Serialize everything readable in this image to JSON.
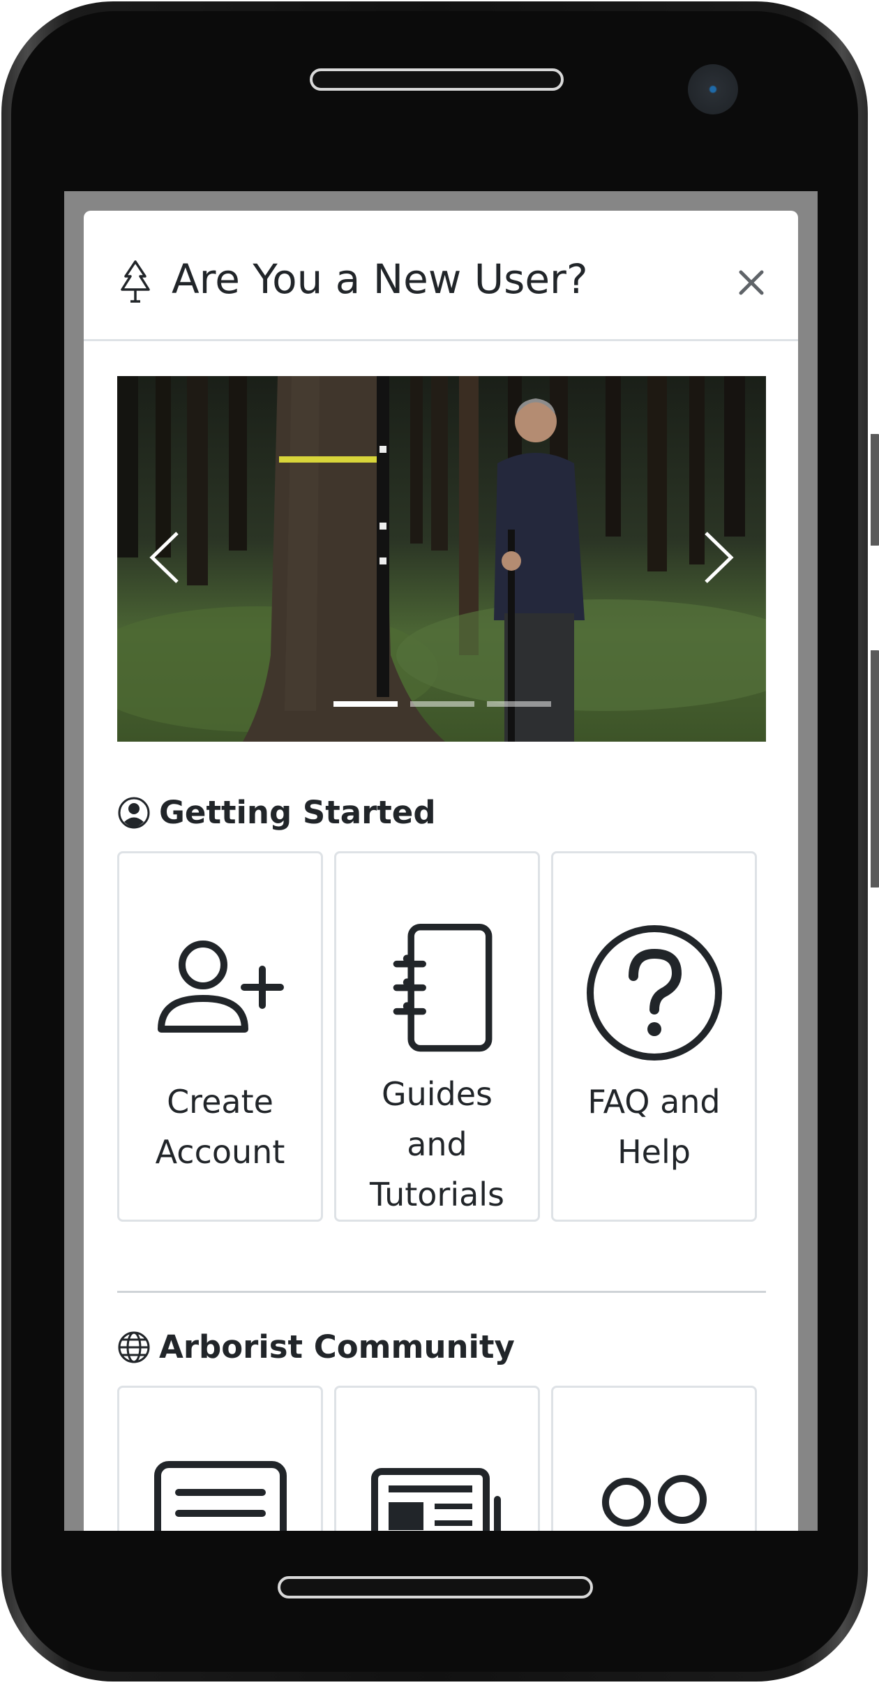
{
  "modal": {
    "title": "Are You a New User?",
    "header_icon": "tree-icon",
    "close_icon": "close-icon"
  },
  "carousel": {
    "slides_count": 3,
    "active_index": 0,
    "prev_icon": "chevron-left-icon",
    "next_icon": "chevron-right-icon"
  },
  "getting_started": {
    "title": "Getting Started",
    "icon": "user-circle-icon",
    "tiles": [
      {
        "icon": "person-add-icon",
        "label": "Create Account"
      },
      {
        "icon": "journal-icon",
        "label": "Guides and Tutorials"
      },
      {
        "icon": "question-circle-icon",
        "label": "FAQ and Help"
      }
    ]
  },
  "community": {
    "title": "Arborist Community",
    "icon": "globe-icon",
    "tiles": [
      {
        "icon": "document-text-icon"
      },
      {
        "icon": "newspaper-icon"
      },
      {
        "icon": "people-icon"
      }
    ]
  },
  "colors": {
    "text": "#212529",
    "border": "#dee2e6",
    "backdrop": "#868686"
  }
}
